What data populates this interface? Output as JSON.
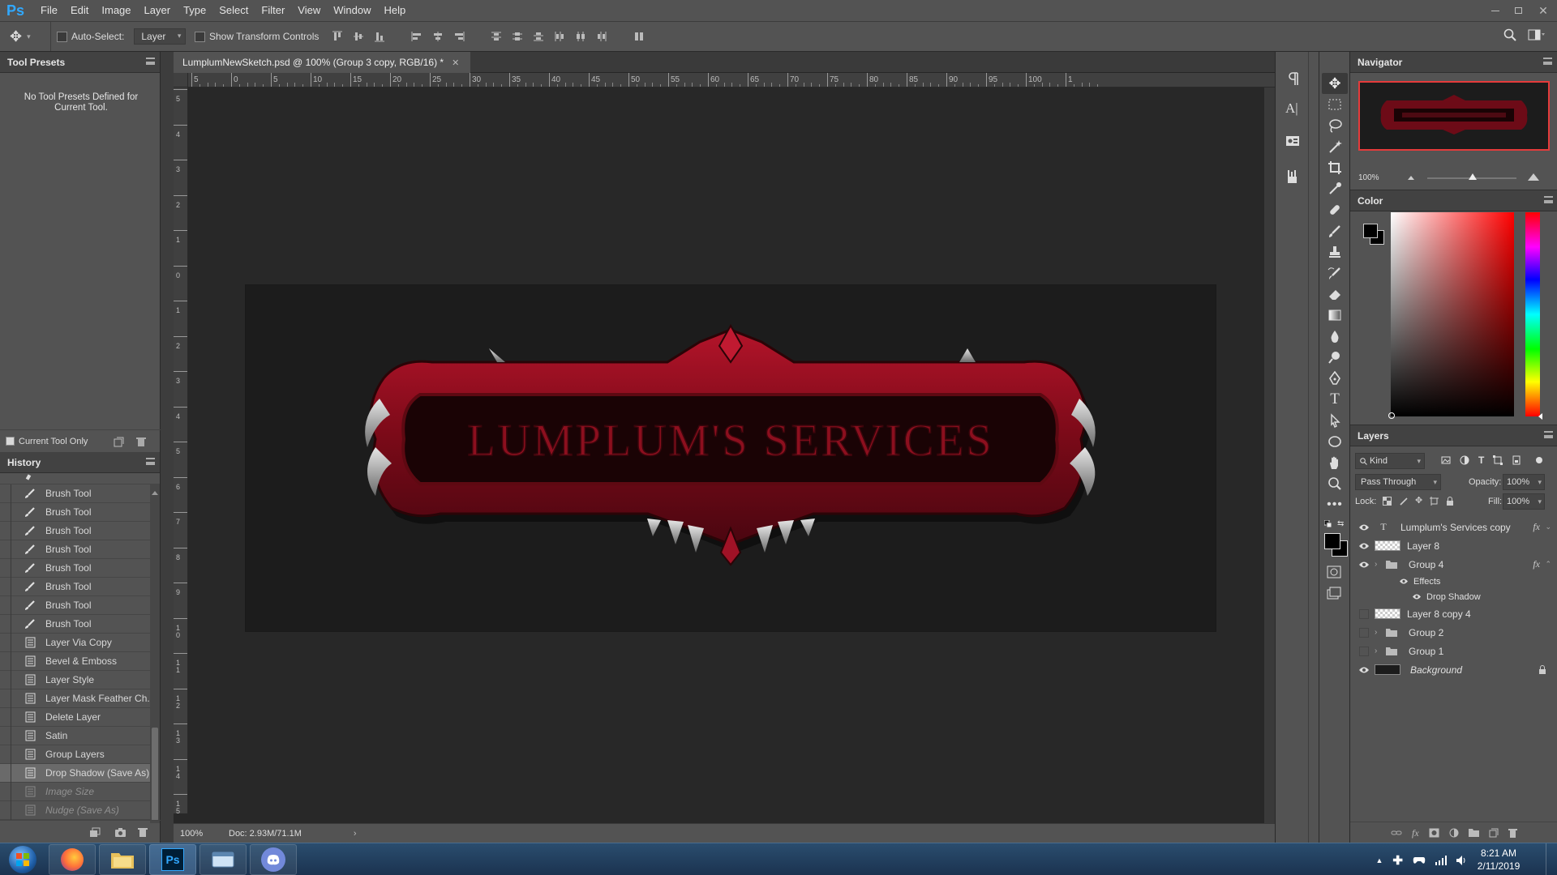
{
  "app": {
    "logo": "Ps",
    "menu": [
      "File",
      "Edit",
      "Image",
      "Layer",
      "Type",
      "Select",
      "Filter",
      "View",
      "Window",
      "Help"
    ]
  },
  "options": {
    "auto_select_label": "Auto-Select:",
    "auto_select_value": "Layer",
    "show_transform_label": "Show Transform Controls"
  },
  "document": {
    "tab_title": "LumplumNewSketch.psd @ 100% (Group 3 copy, RGB/16) *",
    "zoom": "100%",
    "doc_info": "Doc: 2.93M/71.1M"
  },
  "ruler": {
    "h_labels": [
      "5",
      "0",
      "5",
      "10",
      "15",
      "20",
      "25",
      "30",
      "35",
      "40",
      "45",
      "50",
      "55",
      "60",
      "65",
      "70",
      "75",
      "80",
      "85",
      "90",
      "95",
      "100",
      "1"
    ],
    "v_labels": [
      "5",
      "4",
      "3",
      "2",
      "1",
      "0",
      "1",
      "2",
      "3",
      "4",
      "5",
      "6",
      "7",
      "8",
      "9",
      "10",
      "11",
      "12",
      "13",
      "14",
      "15"
    ]
  },
  "canvas": {
    "banner_text": "LUMPLUM'S SERVICES",
    "bg": "#1c1c1c",
    "accent": "#8c0f1e"
  },
  "tool_presets": {
    "title": "Tool Presets",
    "empty_text": "No Tool Presets Defined for Current Tool.",
    "current_tool_only": "Current Tool Only"
  },
  "history": {
    "title": "History",
    "items": [
      {
        "label": "Brush Tool",
        "icon": "brush-icon",
        "state": "normal"
      },
      {
        "label": "Brush Tool",
        "icon": "brush-icon",
        "state": "normal"
      },
      {
        "label": "Brush Tool",
        "icon": "brush-icon",
        "state": "normal"
      },
      {
        "label": "Brush Tool",
        "icon": "brush-icon",
        "state": "normal"
      },
      {
        "label": "Brush Tool",
        "icon": "brush-icon",
        "state": "normal"
      },
      {
        "label": "Brush Tool",
        "icon": "brush-icon",
        "state": "normal"
      },
      {
        "label": "Brush Tool",
        "icon": "brush-icon",
        "state": "normal"
      },
      {
        "label": "Brush Tool",
        "icon": "brush-icon",
        "state": "normal"
      },
      {
        "label": "Layer Via Copy",
        "icon": "document-icon",
        "state": "normal"
      },
      {
        "label": "Bevel & Emboss",
        "icon": "document-icon",
        "state": "normal"
      },
      {
        "label": "Layer Style",
        "icon": "document-icon",
        "state": "normal"
      },
      {
        "label": "Layer Mask Feather Ch...",
        "icon": "document-icon",
        "state": "normal"
      },
      {
        "label": "Delete Layer",
        "icon": "document-icon",
        "state": "normal"
      },
      {
        "label": "Satin",
        "icon": "document-icon",
        "state": "normal"
      },
      {
        "label": "Group Layers",
        "icon": "document-icon",
        "state": "normal"
      },
      {
        "label": "Drop Shadow (Save As)",
        "icon": "document-icon",
        "state": "selected"
      },
      {
        "label": "Image Size",
        "icon": "document-icon",
        "state": "dimmed"
      },
      {
        "label": "Nudge (Save As)",
        "icon": "document-icon",
        "state": "dimmed"
      }
    ]
  },
  "navigator": {
    "title": "Navigator",
    "zoom": "100%"
  },
  "color": {
    "title": "Color"
  },
  "layers": {
    "title": "Layers",
    "kind": "Kind",
    "blend": "Pass Through",
    "opacity_label": "Opacity:",
    "opacity": "100%",
    "lock_label": "Lock:",
    "fill_label": "Fill:",
    "fill": "100%",
    "rows": [
      {
        "name": "Lumplum's Services copy",
        "type": "text",
        "visible": true,
        "fx": true
      },
      {
        "name": "Layer 8",
        "type": "pixel",
        "visible": true,
        "fx": false
      },
      {
        "name": "Group 4",
        "type": "group",
        "visible": true,
        "fx": true
      },
      {
        "name": "Effects",
        "type": "effects",
        "visible": true,
        "fx": false
      },
      {
        "name": "Drop Shadow",
        "type": "effect",
        "visible": true,
        "fx": false
      },
      {
        "name": "Layer 8 copy 4",
        "type": "pixel",
        "visible": false,
        "fx": false
      },
      {
        "name": "Group 2",
        "type": "group",
        "visible": false,
        "fx": false
      },
      {
        "name": "Group 1",
        "type": "group",
        "visible": false,
        "fx": false
      },
      {
        "name": "Background",
        "type": "background",
        "visible": true,
        "fx": false
      }
    ]
  },
  "taskbar": {
    "time": "8:21 AM",
    "date": "2/11/2019"
  }
}
